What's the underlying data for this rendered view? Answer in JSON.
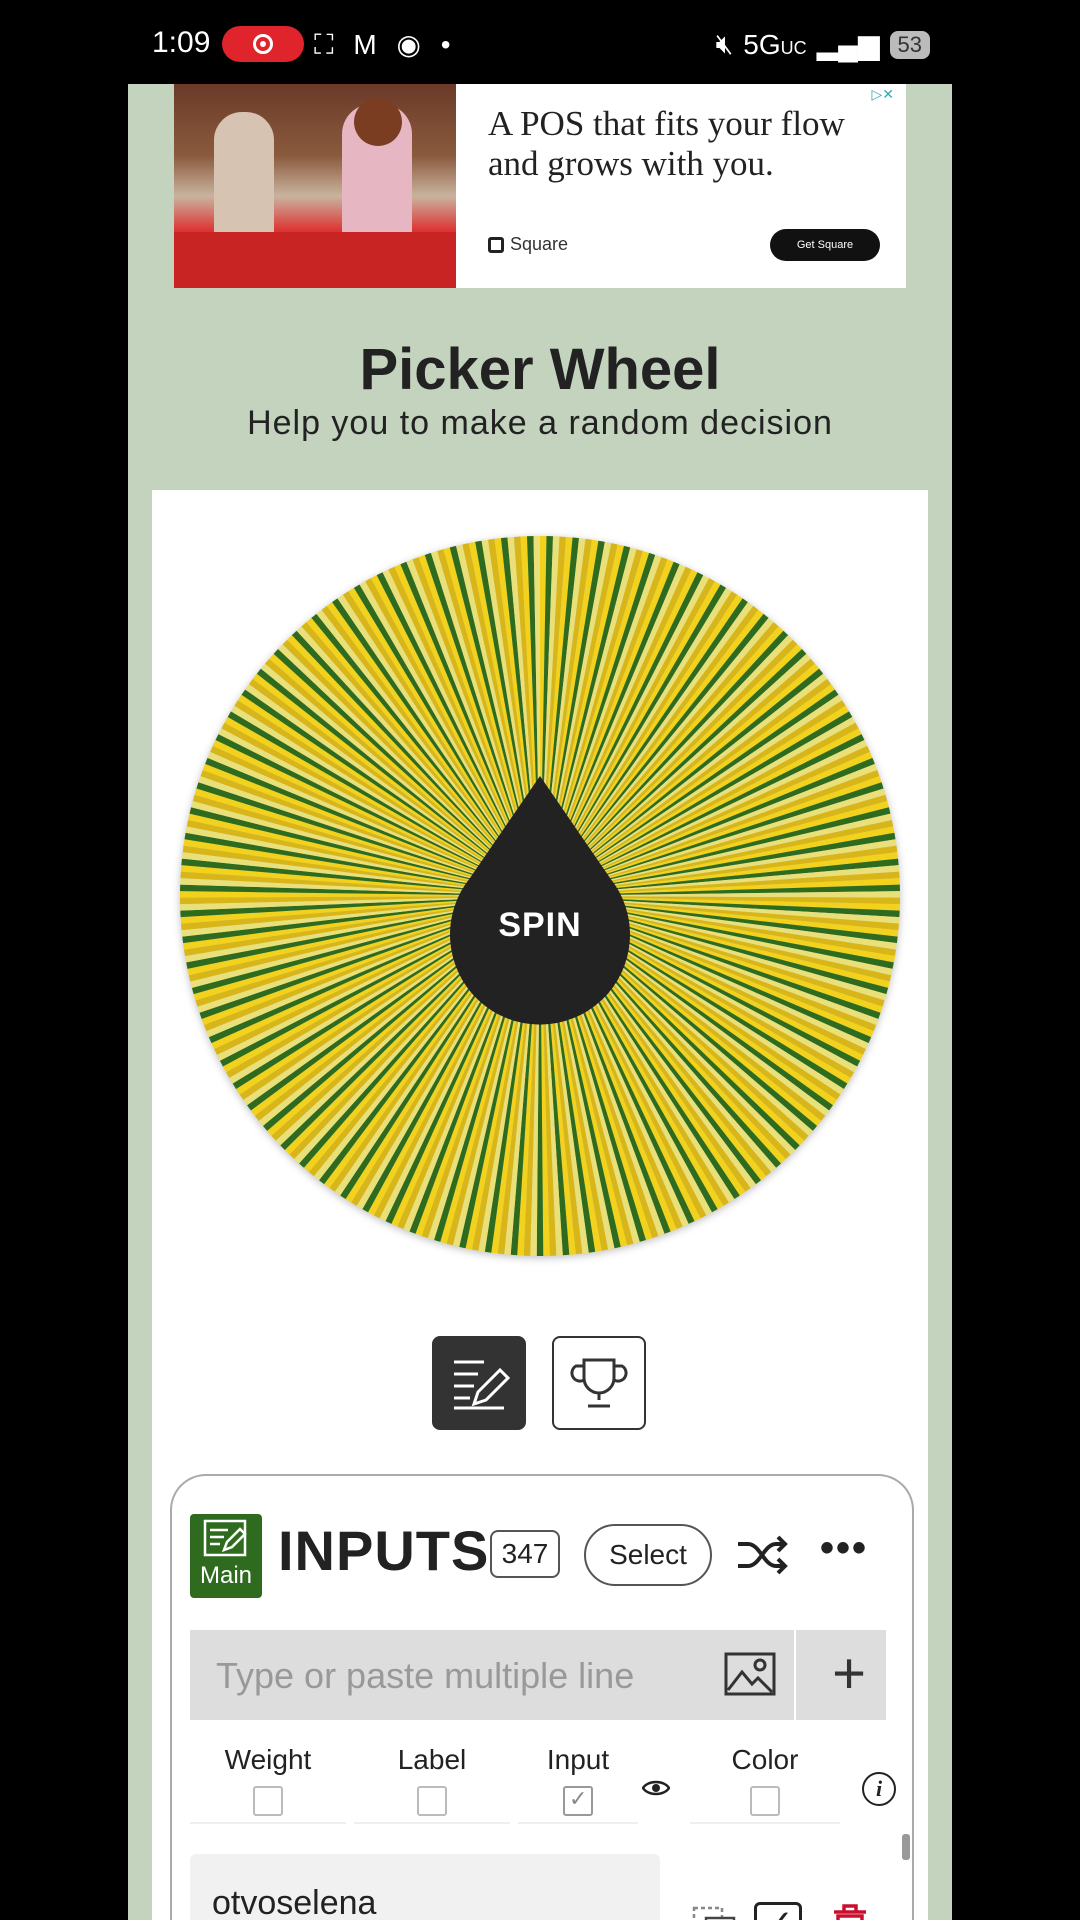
{
  "status_bar": {
    "time": "1:09",
    "icons_left": "⛶ M ◉ •",
    "network": "5G",
    "network_sub": "UC",
    "battery": "53"
  },
  "ad": {
    "headline": "A POS that fits your flow and grows with you.",
    "brand": "Square",
    "cta": "Get Square"
  },
  "header": {
    "title": "Picker Wheel",
    "subtitle": "Help you to make a random decision"
  },
  "wheel": {
    "spin_label": "SPIN",
    "segment_count": 347,
    "colors": [
      "#f2d21c",
      "#2f6b1e",
      "#e9e07a",
      "#d8b61a"
    ]
  },
  "mode_tabs": {
    "edit_icon": "edit-list-icon",
    "results_icon": "trophy-icon"
  },
  "inputs": {
    "badge_label": "Main",
    "title": "INPUTS",
    "count": "347",
    "select_label": "Select",
    "more_label": "•••",
    "add_placeholder": "Type or paste multiple line",
    "columns": [
      {
        "name": "Weight",
        "checked": false
      },
      {
        "name": "Label",
        "checked": false
      },
      {
        "name": "Input",
        "checked": true
      },
      {
        "name": "Color",
        "checked": false
      }
    ],
    "first_entry": "otvoselena"
  },
  "colors": {
    "page_bg": "#c3d3bd",
    "accent_green": "#2e6b1f",
    "delete_red": "#c8102e"
  }
}
